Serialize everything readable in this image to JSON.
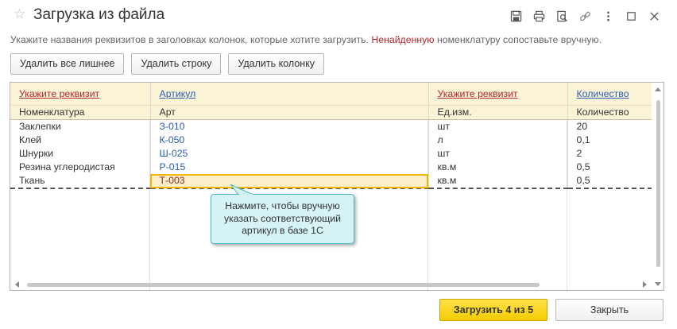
{
  "window": {
    "title": "Загрузка из файла",
    "icons": [
      "save-icon",
      "print-icon",
      "preview-icon",
      "link-icon",
      "more-icon",
      "maximize-icon",
      "close-icon"
    ]
  },
  "hint": {
    "part1": "Укажите названия реквизитов в заголовках колонок, которые хотите загрузить. ",
    "part2_red": "Ненайденную",
    "part3": " номенклатуру сопоставьте вручную."
  },
  "toolbar": {
    "delete_all_extra": "Удалить все лишнее",
    "delete_row": "Удалить строку",
    "delete_column": "Удалить колонку"
  },
  "grid": {
    "header_links": [
      "Укажите реквизит",
      "Артикул",
      "Укажите реквизит",
      "Количество"
    ],
    "header_colors": [
      "#b3262d",
      "#2b5bb5",
      "#b3262d",
      "#2b5bb5"
    ],
    "column_names": [
      "Номенклатура",
      "Арт",
      "Ед.изм.",
      "Количество"
    ],
    "rows": [
      [
        "Заклепки",
        "З-010",
        "шт",
        "20"
      ],
      [
        "Клей",
        "К-050",
        "л",
        "0,1"
      ],
      [
        "Шнурки",
        "Ш-025",
        "шт",
        "2"
      ],
      [
        "Резина углеродистая",
        "Р-015",
        "кв.м",
        "0,5"
      ],
      [
        "Ткань",
        "Т-003",
        "кв.м",
        "0,5"
      ]
    ]
  },
  "tooltip": {
    "line1": "Нажмите, чтобы вручную",
    "line2": "указать соответствующий",
    "line3": "артикул в базе 1С"
  },
  "footer": {
    "load_button": "Загрузить 4 из 5",
    "close_button": "Закрыть"
  },
  "colors": {
    "accent_yellow": "#f4cc00",
    "header_bg": "#fbf3d5",
    "tooltip_bg": "#d5f3f4",
    "tooltip_border": "#49bcc2",
    "warning_red": "#b3262d",
    "link_blue": "#2b5bb5"
  }
}
